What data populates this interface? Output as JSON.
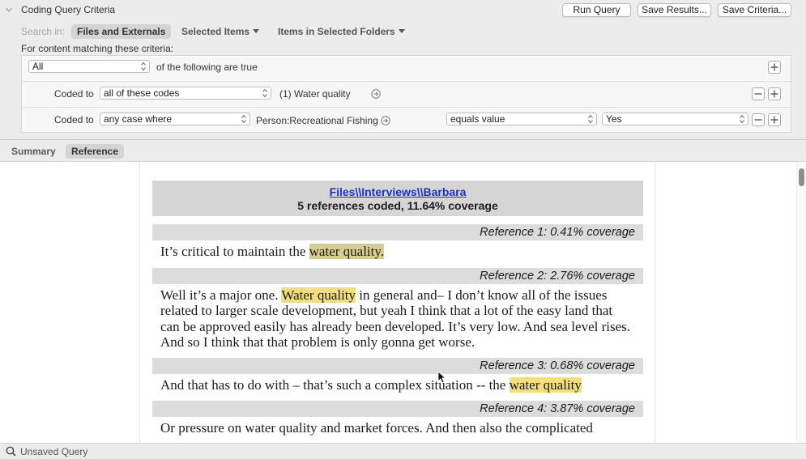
{
  "criteria": {
    "title": "Coding Query Criteria",
    "buttons": {
      "run": "Run Query",
      "save_results": "Save Results...",
      "save_criteria": "Save Criteria..."
    },
    "search_in_label": "Search in:",
    "scope_options": [
      "Files and Externals",
      "Items in Selected Folders"
    ],
    "selected_items_label": "Selected Items",
    "content_matching_label": "For content matching these criteria:",
    "match_mode": "All",
    "match_suffix": "of the following are true",
    "rows": [
      {
        "label": "Coded to",
        "operator": "all of these codes",
        "value": "(1) Water quality"
      },
      {
        "label": "Coded to",
        "operator": "any case where",
        "attribute": "Person:Recreational Fishing",
        "comparison": "equals value",
        "value": "Yes"
      }
    ]
  },
  "tabs": [
    "Summary",
    "Reference"
  ],
  "document": {
    "file_link": "Files\\\\Interviews\\\\Barbara",
    "summary": "5 references coded, 11.64% coverage",
    "references": [
      {
        "header": "Reference 1: 0.41% coverage",
        "text_before": "It’s critical to maintain the ",
        "highlight": "water quality.",
        "text_after": ""
      },
      {
        "header": "Reference 2: 2.76% coverage",
        "line1_before": "Well it’s a major one. ",
        "highlight": "Water quality",
        "line1_after": " in general and– I don’t know all of the issues",
        "line2": "related to larger scale development, but yeah I think that a lot of the easy land that",
        "line3": "can be approved easily has already been developed. It’s very low. And sea level rises.",
        "line4": "And so I think that that problem is only gonna get worse."
      },
      {
        "header": "Reference 3: 0.68% coverage",
        "text_before": "And that has to do with – that’s such a complex situation -- the ",
        "highlight": "water quality",
        "text_after": ""
      },
      {
        "header": "Reference 4: 3.87% coverage",
        "text": "Or pressure on water quality and market forces. And then also the complicated"
      }
    ]
  },
  "status": {
    "text": "Unsaved Query"
  },
  "colors": {
    "highlight": "#f2df7c",
    "link": "#1a2fd6",
    "ref_bar": "#dcdcdc",
    "header_bar": "#d6d6d6"
  }
}
